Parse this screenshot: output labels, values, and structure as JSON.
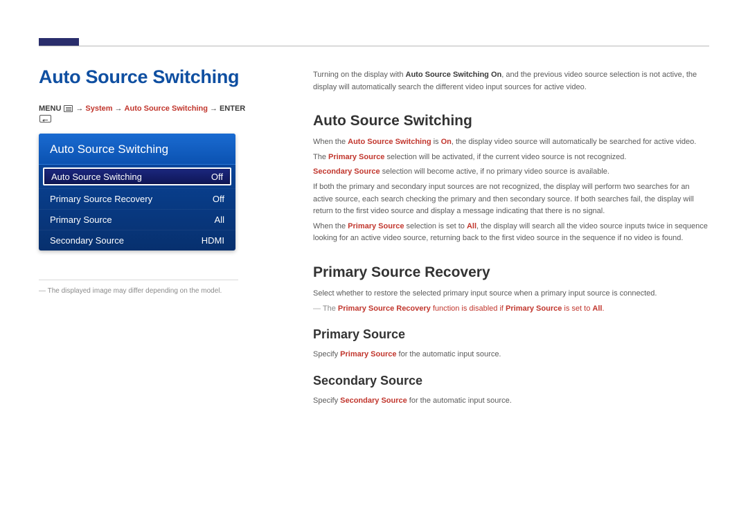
{
  "left": {
    "heading": "Auto Source Switching",
    "breadcrumb": {
      "menu": "MENU",
      "arrow": "→",
      "system": "System",
      "auto_source": "Auto Source Switching",
      "enter": "ENTER"
    },
    "panel": {
      "title": "Auto Source Switching",
      "rows": [
        {
          "label": "Auto Source Switching",
          "value": "Off"
        },
        {
          "label": "Primary Source Recovery",
          "value": "Off"
        },
        {
          "label": "Primary Source",
          "value": "All"
        },
        {
          "label": "Secondary Source",
          "value": "HDMI"
        }
      ]
    },
    "footnote": "The displayed image may differ depending on the model."
  },
  "right": {
    "intro_pre": "Turning on the display with ",
    "intro_emph": "Auto Source Switching On",
    "intro_post": ", and the previous video source selection is not active, the display will automatically search the different video input sources for active video.",
    "s1": {
      "heading": "Auto Source Switching",
      "p1_pre": "When the ",
      "p1_e1": "Auto Source Switching",
      "p1_mid": " is ",
      "p1_e2": "On",
      "p1_post": ", the display video source will automatically be searched for active video.",
      "p2_pre": "The ",
      "p2_e1": "Primary Source",
      "p2_post": " selection will be activated, if the current video source is not recognized.",
      "p3_e1": "Secondary Source",
      "p3_post": " selection will become active, if no primary video source is available.",
      "p4": "If both the primary and secondary input sources are not recognized, the display will perform two searches for an active source, each search checking the primary and then secondary source. If both searches fail, the display will return to the first video source and display a message indicating that there is no signal.",
      "p5_pre": "When the ",
      "p5_e1": "Primary Source",
      "p5_mid": " selection is set to ",
      "p5_e2": "All",
      "p5_post": ", the display will search all the video source inputs twice in sequence looking for an active video source, returning back to the first video source in the sequence if no video is found."
    },
    "s2": {
      "heading": "Primary Source Recovery",
      "p1": "Select whether to restore the selected primary input source when a primary input source is connected.",
      "note_pre": "The ",
      "note_e1": "Primary Source Recovery",
      "note_mid": " function is disabled if ",
      "note_e2": "Primary Source",
      "note_mid2": " is set to ",
      "note_e3": "All",
      "note_post": "."
    },
    "s3": {
      "heading": "Primary Source",
      "p1_pre": "Specify ",
      "p1_e1": "Primary Source",
      "p1_post": " for the automatic input source."
    },
    "s4": {
      "heading": "Secondary Source",
      "p1_pre": "Specify ",
      "p1_e1": "Secondary Source",
      "p1_post": " for the automatic input source."
    }
  }
}
